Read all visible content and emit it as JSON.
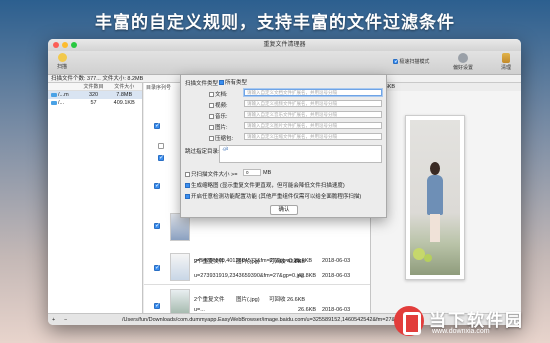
{
  "banner": "丰富的自定义规则，支持丰富的文件过滤条件",
  "window": {
    "title": "重复文件清理器"
  },
  "toolbar": {
    "scan": "扫描",
    "advanced_mode": "极速扫描模式",
    "preferences": "偏好设置",
    "clean": "清理"
  },
  "status": {
    "summary": "扫描文件个数: 377... 文件大小: 8.2MB",
    "right_size": "880.6KB"
  },
  "left": {
    "headers": [
      "",
      "文件数目",
      "文件大小"
    ],
    "rows": [
      {
        "name": "/...m",
        "count": "320",
        "size": "7.8MB"
      },
      {
        "name": "/...",
        "count": "57",
        "size": "409.1KB"
      }
    ]
  },
  "middle": {
    "header": "目录序列号",
    "items": [
      {
        "path": "u=54256660,4012864573&fm=27&gp=0.jpg",
        "size": "25.9KB",
        "date": "2018-06-03"
      },
      {
        "title": "2个重复文件",
        "type": "图片(.jpg)",
        "reclaim": "可回收 42.8KB",
        "path": "u=273931919,2343659390&fm=27&gp=0.jpg",
        "size": "42.8KB",
        "date": "2018-06-03"
      },
      {
        "title": "2个重复文件",
        "type": "图片(.jpg)",
        "reclaim": "可回收 26.6KB",
        "path": "u=...",
        "size": "26.6KB",
        "date": "2018-06-03"
      }
    ]
  },
  "dialog": {
    "scan_types": "扫描文件类型",
    "all_types": "所有类型",
    "types": [
      {
        "label": "文档:",
        "placeholder": "请输入自定义文档文件扩展名，并用逗号分隔"
      },
      {
        "label": "视频:",
        "placeholder": "请输入自定义视频文件扩展名，并用逗号分隔"
      },
      {
        "label": "音乐:",
        "placeholder": "请输入自定义音乐文件扩展名，并用逗号分隔"
      },
      {
        "label": "图片:",
        "placeholder": "请输入自定义图片文件扩展名，并用逗号分隔"
      },
      {
        "label": "压缩包:",
        "placeholder": "请输入自定义压缩文件扩展名，并用逗号分隔"
      }
    ],
    "skip_dirs": "跳过指定目录:",
    "skip_value": ".git",
    "min_size_label": "只扫描文件大小 >=",
    "min_size_value": "0",
    "min_size_unit": "MB",
    "thumb_opt": "生成缩略图 (显示重复文件更直观，但可能会降低文件扫描速度)",
    "fast_opt": "开启任意检测功能配置功能 (其他严重组件仅需可以给全面脆程序扫描)",
    "ok": "确认"
  },
  "bottom": {
    "add": "+",
    "remove": "−",
    "path": "/Users/fun/Downloads/com.dummyapp.EasyWebBrowser/image.baidu.com/u=325589152,1460542542&fm=27&gp=0.jpg"
  },
  "watermark": {
    "text": "当下软件园",
    "url": "www.downxia.com"
  },
  "colors": {
    "accent": "#3b8ff0",
    "banner_bg": "#2c5f8f",
    "watermark_red": "#e23d3b"
  }
}
